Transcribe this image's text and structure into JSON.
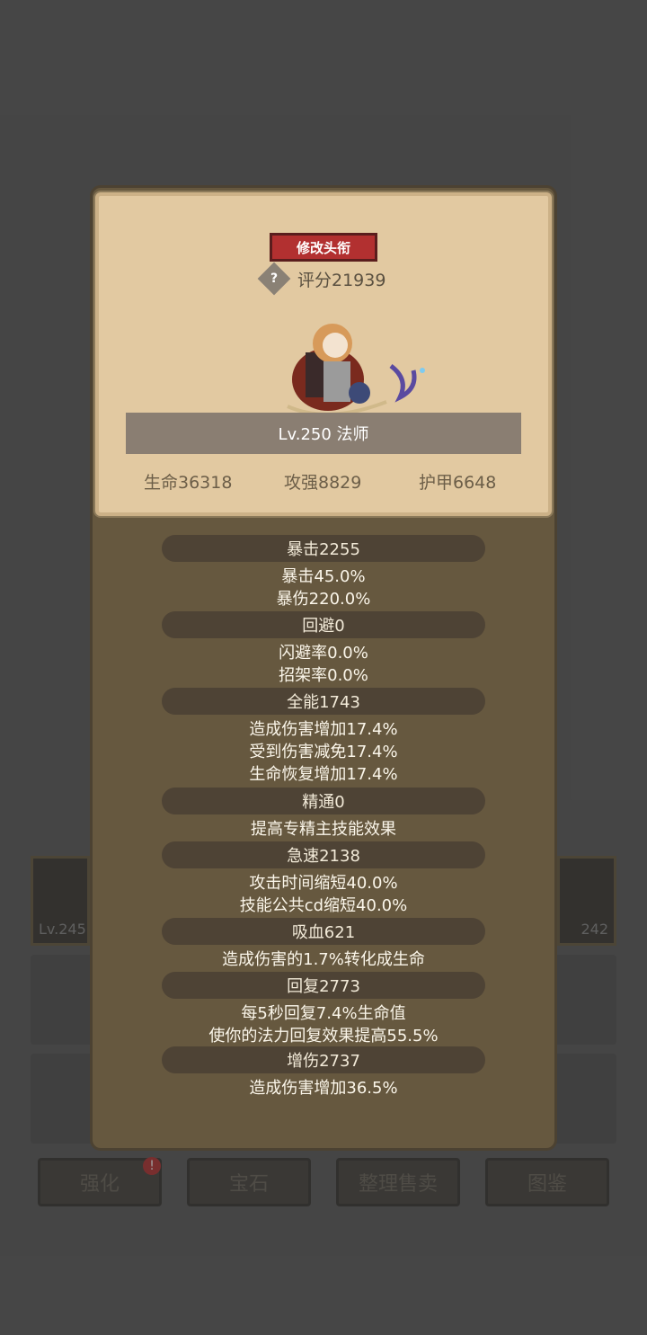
{
  "header": {
    "rename_button": "修改头衔",
    "help_icon": "?",
    "score": "评分21939",
    "name_level": "Lv.250 法师",
    "hp": "生命36318",
    "attack": "攻强8829",
    "armor": "护甲6648"
  },
  "stats": [
    {
      "label": "暴击2255",
      "lines": [
        "暴击45.0%",
        "暴伤220.0%"
      ]
    },
    {
      "label": "回避0",
      "lines": [
        "闪避率0.0%",
        "招架率0.0%"
      ]
    },
    {
      "label": "全能1743",
      "lines": [
        "造成伤害增加17.4%",
        "受到伤害减免17.4%",
        "生命恢复增加17.4%"
      ]
    },
    {
      "label": "精通0",
      "lines": [
        "提高专精主技能效果"
      ]
    },
    {
      "label": "急速2138",
      "lines": [
        "攻击时间缩短40.0%",
        "技能公共cd缩短40.0%"
      ]
    },
    {
      "label": "吸血621",
      "lines": [
        "造成伤害的1.7%转化成生命"
      ]
    },
    {
      "label": "回复2773",
      "lines": [
        "每5秒回复7.4%生命值",
        "使你的法力回复效果提高55.5%"
      ]
    },
    {
      "label": "增伤2737",
      "lines": [
        "造成伤害增加36.5%"
      ]
    }
  ],
  "background": {
    "left_slot_level": "Lv.245",
    "right_slot_level": "242",
    "buttons": [
      "强化",
      "宝石",
      "整理售卖",
      "图鉴"
    ],
    "badge": "!"
  }
}
